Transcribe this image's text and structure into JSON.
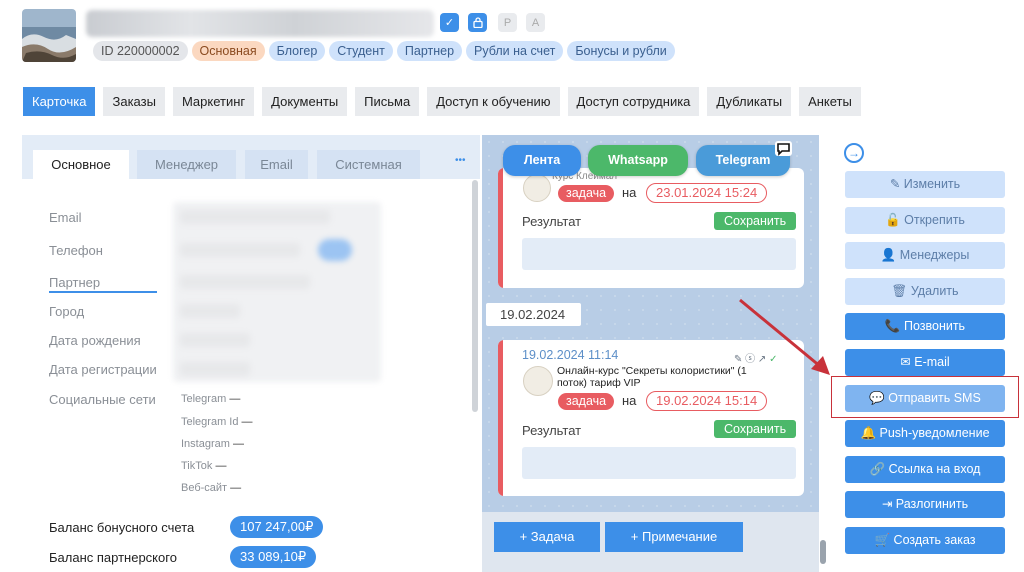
{
  "header": {
    "id_tag": "ID 220000002",
    "tags": [
      "Основная",
      "Блогер",
      "Студент",
      "Партнер",
      "Рубли на счет",
      "Бонусы и рубли"
    ],
    "badges": [
      {
        "label": "✓",
        "icon": "checkmark-icon",
        "color": "#3d8fe8"
      },
      {
        "label": "🔒",
        "icon": "lock-icon",
        "color": "#3d8fe8"
      },
      {
        "label": "P",
        "icon": "p-badge",
        "color": "#e9ebee"
      },
      {
        "label": "A",
        "icon": "a-badge",
        "color": "#e9ebee"
      }
    ]
  },
  "tabs": [
    "Карточка",
    "Заказы",
    "Маркетинг",
    "Документы",
    "Письма",
    "Доступ к обучению",
    "Доступ сотрудника",
    "Дубликаты",
    "Анкеты"
  ],
  "subtabs": [
    "Основное",
    "Менеджер",
    "Email",
    "Системная"
  ],
  "subtabs_more": "•••",
  "fields": [
    "Email",
    "Телефон",
    "Партнер",
    "Город",
    "Дата рождения",
    "Дата регистрации",
    "Социальные сети"
  ],
  "social": [
    {
      "label": "Telegram",
      "value": "—"
    },
    {
      "label": "Telegram Id",
      "value": "—"
    },
    {
      "label": "Instagram",
      "value": "—"
    },
    {
      "label": "TikTok",
      "value": "—"
    },
    {
      "label": "Веб-сайт",
      "value": "—"
    }
  ],
  "balances": [
    {
      "label": "Баланс бонусного счета",
      "value": "107 247,00₽"
    },
    {
      "label": "Баланс партнерского",
      "value": "33 089,10₽"
    }
  ],
  "feed": {
    "buttons": [
      {
        "label": "Лента",
        "color": "#3d8fe8"
      },
      {
        "label": "Whatsapp",
        "color": "#4cb86a"
      },
      {
        "label": "Telegram",
        "color": "#4a9bd9"
      }
    ],
    "card1": {
      "partial_text": "Курс Клеймал",
      "type": "задача",
      "on": "на",
      "date": "23.01.2024 15:24",
      "result_label": "Результат",
      "save": "Сохранить"
    },
    "divider": "19.02.2024",
    "card2": {
      "timestamp": "19.02.2024 11:14",
      "title": "Онлайн-курс \"Секреты колористики\" (1 поток) тариф VIP",
      "type": "задача",
      "on": "на",
      "date": "19.02.2024 15:14",
      "result_label": "Результат",
      "save": "Сохранить"
    },
    "add_task": "+ Задача",
    "add_note": "+ Примечание"
  },
  "actions": [
    {
      "label": "Изменить",
      "icon": "✎",
      "style": "disabled"
    },
    {
      "label": "Открепить",
      "icon": "🔓",
      "style": "disabled"
    },
    {
      "label": "Менеджеры",
      "icon": "👤",
      "style": "disabled"
    },
    {
      "label": "Удалить",
      "icon": "🗑",
      "style": "disabled"
    },
    {
      "label": "Позвонить",
      "icon": "📞",
      "style": "primary"
    },
    {
      "label": "E-mail",
      "icon": "✉",
      "style": "primary"
    },
    {
      "label": "Отправить SMS",
      "icon": "💬",
      "style": "sms"
    },
    {
      "label": "Push-уведомление",
      "icon": "🔔",
      "style": "primary"
    },
    {
      "label": "Ссылка на вход",
      "icon": "🔗",
      "style": "primary"
    },
    {
      "label": "Разлогинить",
      "icon": "⇥",
      "style": "primary"
    },
    {
      "label": "Создать заказ",
      "icon": "🛒",
      "style": "primary"
    }
  ],
  "colors": {
    "accent": "#3d8fe8",
    "task_red": "#e85c61",
    "save_green": "#4cb86a",
    "annotation_red": "#c8323a"
  }
}
